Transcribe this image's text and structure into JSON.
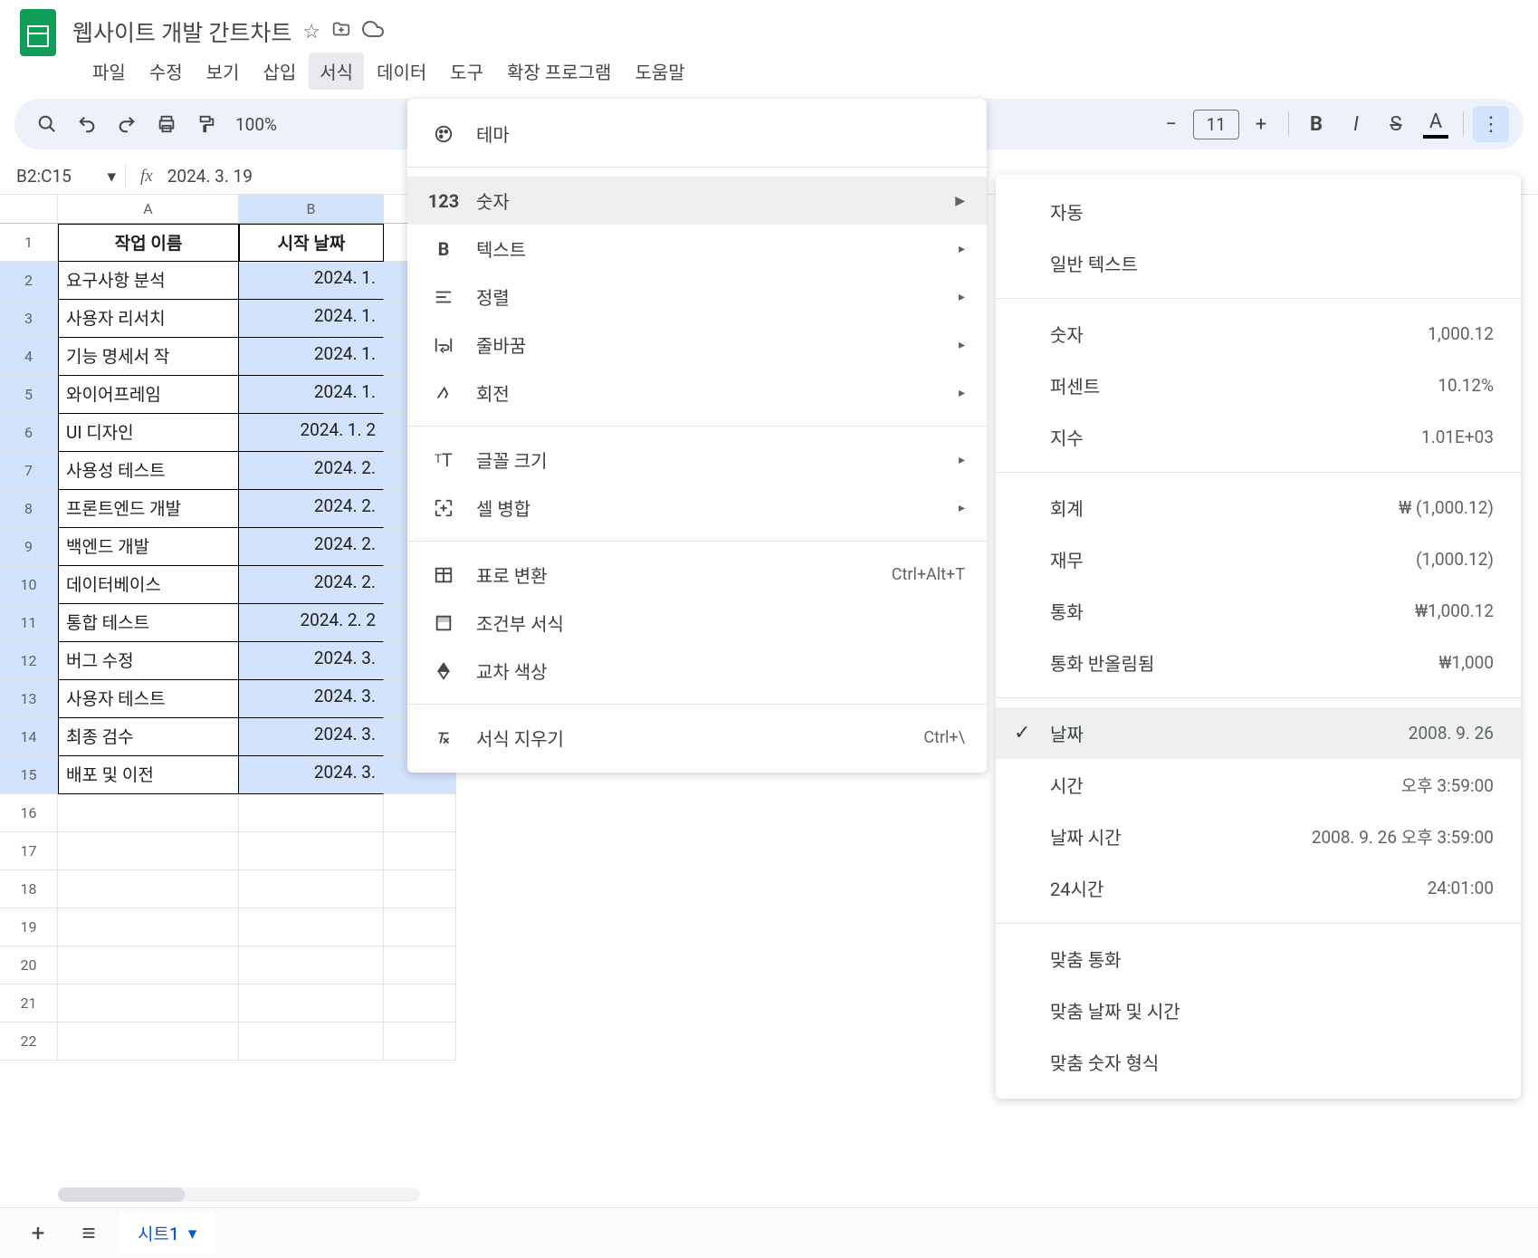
{
  "header": {
    "doc_title": "웹사이트 개발 간트차트"
  },
  "menubar": {
    "file": "파일",
    "edit": "수정",
    "view": "보기",
    "insert": "삽입",
    "format": "서식",
    "data": "데이터",
    "tools": "도구",
    "extensions": "확장 프로그램",
    "help": "도움말"
  },
  "toolbar": {
    "zoom": "100%",
    "font_size": "11"
  },
  "fx_bar": {
    "cell_ref": "B2:C15",
    "value": "2024. 3. 19"
  },
  "columns": {
    "A": "A",
    "B": "B"
  },
  "headers": {
    "task": "작업 이름",
    "start": "시작 날짜"
  },
  "rows": [
    {
      "n": "1"
    },
    {
      "n": "2",
      "task": "요구사항 분석",
      "date": "2024. 1."
    },
    {
      "n": "3",
      "task": "사용자 리서치",
      "date": "2024. 1."
    },
    {
      "n": "4",
      "task": "기능 명세서 작",
      "date": "2024. 1. "
    },
    {
      "n": "5",
      "task": "와이어프레임 ",
      "date": "2024. 1. "
    },
    {
      "n": "6",
      "task": "UI 디자인",
      "date": "2024. 1. 2"
    },
    {
      "n": "7",
      "task": "사용성 테스트",
      "date": "2024. 2."
    },
    {
      "n": "8",
      "task": "프론트엔드 개발",
      "date": "2024. 2."
    },
    {
      "n": "9",
      "task": "백엔드 개발",
      "date": "2024. 2."
    },
    {
      "n": "10",
      "task": "데이터베이스 ",
      "date": "2024. 2. "
    },
    {
      "n": "11",
      "task": "통합 테스트",
      "date": "2024. 2. 2"
    },
    {
      "n": "12",
      "task": "버그 수정",
      "date": "2024. 3."
    },
    {
      "n": "13",
      "task": "사용자 테스트",
      "date": "2024. 3."
    },
    {
      "n": "14",
      "task": "최종 검수",
      "date": "2024. 3. "
    },
    {
      "n": "15",
      "task": "배포 및 이전",
      "date": "2024. 3. "
    },
    {
      "n": "16"
    },
    {
      "n": "17"
    },
    {
      "n": "18"
    },
    {
      "n": "19"
    },
    {
      "n": "20"
    },
    {
      "n": "21"
    },
    {
      "n": "22"
    }
  ],
  "format_menu": {
    "theme": "테마",
    "number": "숫자",
    "text": "텍스트",
    "alignment": "정렬",
    "wrapping": "줄바꿈",
    "rotation": "회전",
    "font_size": "글꼴 크기",
    "merge": "셀 병합",
    "table": "표로 변환",
    "table_shortcut": "Ctrl+Alt+T",
    "conditional": "조건부 서식",
    "alternating": "교차 색상",
    "clear": "서식 지우기",
    "clear_shortcut": "Ctrl+\\"
  },
  "number_menu": {
    "auto": "자동",
    "plain": "일반 텍스트",
    "number": "숫자",
    "number_sample": "1,000.12",
    "percent": "퍼센트",
    "percent_sample": "10.12%",
    "scientific": "지수",
    "scientific_sample": "1.01E+03",
    "accounting": "회계",
    "accounting_sample": "₩ (1,000.12)",
    "financial": "재무",
    "financial_sample": "(1,000.12)",
    "currency": "통화",
    "currency_sample": "₩1,000.12",
    "currency_rounded": "통화 반올림됨",
    "currency_rounded_sample": "₩1,000",
    "date": "날짜",
    "date_sample": "2008. 9. 26",
    "time": "시간",
    "time_sample": "오후 3:59:00",
    "datetime": "날짜 시간",
    "datetime_sample": "2008. 9. 26 오후 3:59:00",
    "duration": "24시간",
    "duration_sample": "24:01:00",
    "custom_currency": "맞춤 통화",
    "custom_datetime": "맞춤 날짜 및 시간",
    "custom_number": "맞춤 숫자 형식"
  },
  "tabs": {
    "sheet1": "시트1"
  }
}
